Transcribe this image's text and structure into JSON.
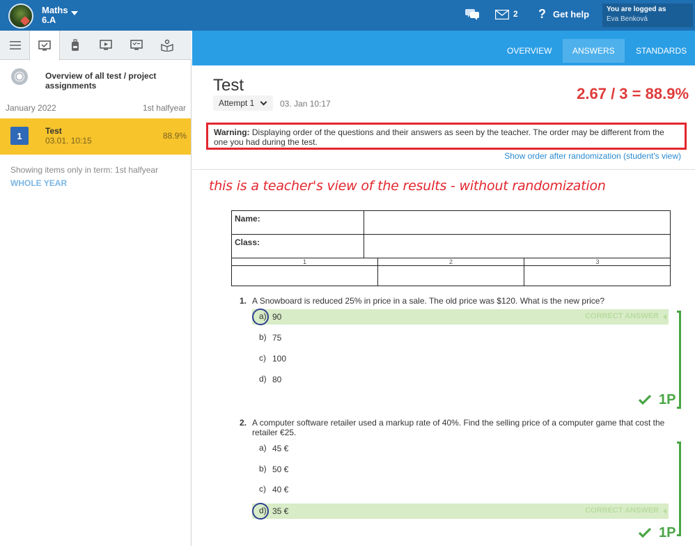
{
  "header": {
    "course_name": "Maths",
    "course_class": "6.A",
    "messages_count": "2",
    "help_label": "Get help",
    "logged_in_label": "You are logged as",
    "user_name": "Eva Benková"
  },
  "sidebar": {
    "overview_label": "Overview of all test / project assignments",
    "term_month": "January 2022",
    "term_half": "1st halfyear",
    "test_item": {
      "number": "1",
      "title": "Test",
      "datetime": "03.01. 10:15",
      "score": "88.9%"
    },
    "showing_text": "Showing items only in term: 1st halfyear",
    "whole_year_label": "WHOLE YEAR"
  },
  "nav": {
    "overview": "OVERVIEW",
    "answers": "ANSWERS",
    "standards": "STANDARDS"
  },
  "test": {
    "title": "Test",
    "attempt_label": "Attempt 1",
    "attempt_date": "03. Jan 10:17",
    "score": "2.67 / 3 = 88.9%",
    "warning_label": "Warning:",
    "warning_text": " Displaying order of the questions and their answers as seen by the teacher. The order may be different from the one you had during the test.",
    "show_order_link": "Show order after randomization (student's view)",
    "annotation": "this is a teacher's view of the results - without randomization"
  },
  "form_header": {
    "name_label": "Name:",
    "class_label": "Class:",
    "columns": [
      "1",
      "2",
      "3"
    ]
  },
  "questions": [
    {
      "number": "1.",
      "text": "A Snowboard is reduced 25% in price in a sale. The old price was $120. What is the new price?",
      "answers": [
        {
          "letter": "a)",
          "text": "90"
        },
        {
          "letter": "b)",
          "text": "75"
        },
        {
          "letter": "c)",
          "text": "100"
        },
        {
          "letter": "d)",
          "text": "80"
        }
      ],
      "correct_label": "CORRECT ANSWER",
      "points": "1P"
    },
    {
      "number": "2.",
      "text_line1": "A computer software retailer used a markup rate of 40%. Find the selling price of a computer game that cost the",
      "text_line2": "retailer €25.",
      "answers": [
        {
          "letter": "a)",
          "text": "45 €"
        },
        {
          "letter": "b)",
          "text": "50 €"
        },
        {
          "letter": "c)",
          "text": "40 €"
        },
        {
          "letter": "d)",
          "text": "35 €"
        }
      ],
      "correct_label": "CORRECT ANSWER",
      "points": "1P"
    }
  ]
}
